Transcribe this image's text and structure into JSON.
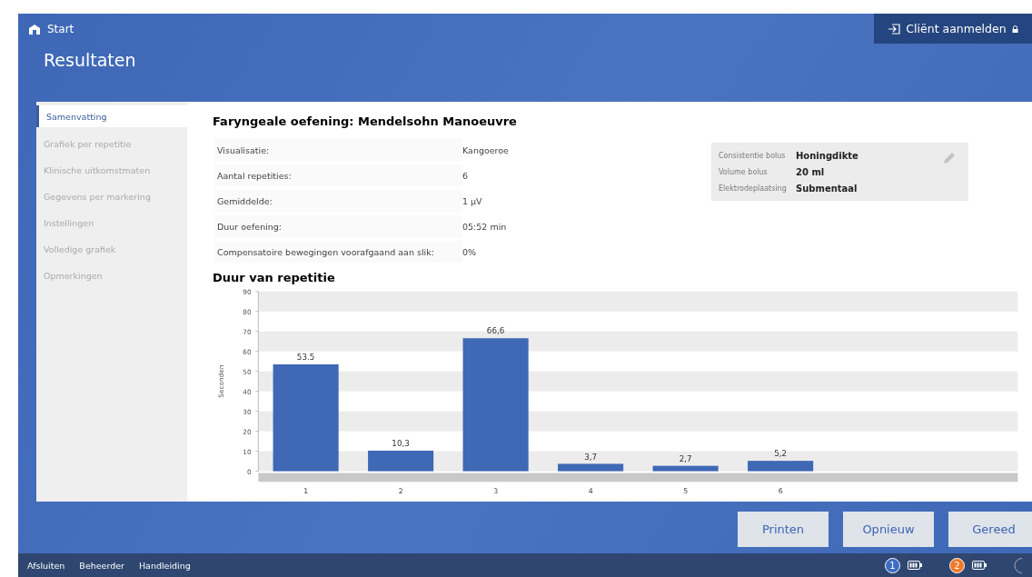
{
  "header": {
    "home_label": "Start",
    "title": "Resultaten",
    "login_button": "Cliënt aanmelden"
  },
  "sidebar": {
    "items": [
      {
        "label": "Samenvatting",
        "selected": true
      },
      {
        "label": "Grafiek per repetitie",
        "selected": false
      },
      {
        "label": "Klinische uitkomstmaten",
        "selected": false
      },
      {
        "label": "Gegevens per markering",
        "selected": false
      },
      {
        "label": "Instellingen",
        "selected": false
      },
      {
        "label": "Volledige grafiek",
        "selected": false
      },
      {
        "label": "Opmerkingen",
        "selected": false
      }
    ]
  },
  "summary": {
    "title": "Faryngeale oefening: Mendelsohn Manoeuvre",
    "rows": [
      {
        "label": "Visualisatie:",
        "value": "Kangoeroe"
      },
      {
        "label": "Aantal repetities:",
        "value": "6"
      },
      {
        "label": "Gemiddelde:",
        "value": "1 µV"
      },
      {
        "label": "Duur oefening:",
        "value": "05:52 min"
      },
      {
        "label": "Compensatoire bewegingen voorafgaand aan slik:",
        "value": "0%"
      }
    ]
  },
  "bolus_card": {
    "rows": [
      {
        "label": "Consistentie bolus",
        "value": "Honingdikte"
      },
      {
        "label": "Volume bolus",
        "value": "20 ml"
      },
      {
        "label": "Elektrodeplaatsing",
        "value": "Submentaal"
      }
    ]
  },
  "chart": {
    "title": "Duur van repetitie",
    "chart_data": {
      "type": "bar",
      "ylabel": "Seconden",
      "categories": [
        "1",
        "2",
        "3",
        "4",
        "5",
        "6"
      ],
      "series": [
        {
          "color": "#3f68b5",
          "values": [
            53.5,
            10.3,
            66.6,
            3.7,
            2.7,
            5.2
          ]
        }
      ],
      "value_labels": [
        "53.5",
        "10,3",
        "66,6",
        "3,7",
        "2,7",
        "5,2"
      ],
      "ylim": [
        0,
        90
      ],
      "yticks": [
        0,
        10,
        20,
        30,
        40,
        50,
        60,
        70,
        80,
        90
      ]
    }
  },
  "buttons": [
    "Printen",
    "Opnieuw",
    "Gereed"
  ],
  "status_bar": {
    "links": [
      "Afsluiten",
      "Beheerder",
      "Handleiding"
    ],
    "devices": [
      {
        "number": "1",
        "color": "#3d6cc4"
      },
      {
        "number": "2",
        "color": "#f07a2a"
      }
    ]
  }
}
